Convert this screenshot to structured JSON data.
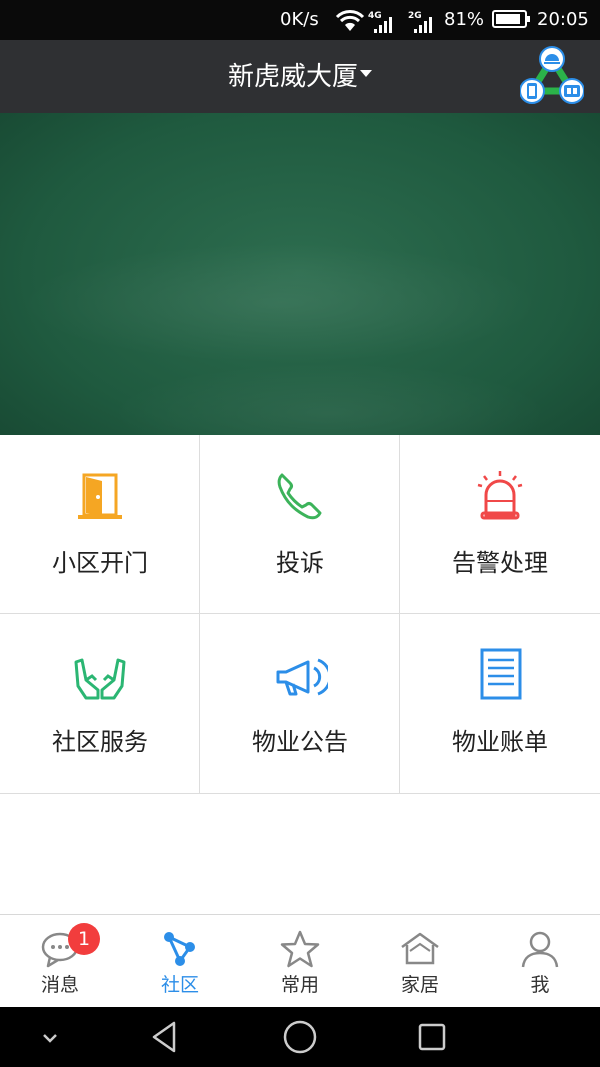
{
  "status_bar": {
    "network_speed": "0K/s",
    "net_4g": "4G",
    "net_2g": "2G",
    "battery_percent": "81%",
    "time": "20:05",
    "icons": [
      "wifi-icon",
      "signal-icon",
      "battery-icon"
    ]
  },
  "header": {
    "title": "新虎威大厦",
    "logo_icon": "smart-home-network-logo",
    "colors": {
      "background": "#2f3033",
      "title": "#ffffff"
    }
  },
  "banner": {
    "description_icon": "green-chalkboard-banner"
  },
  "services": [
    {
      "label": "小区开门",
      "icon": "door-icon",
      "color": "#f5a623"
    },
    {
      "label": "投诉",
      "icon": "phone-icon",
      "color": "#3cb35a"
    },
    {
      "label": "告警处理",
      "icon": "alarm-light-icon",
      "color": "#f04848"
    },
    {
      "label": "社区服务",
      "icon": "hands-icon",
      "color": "#2bb673"
    },
    {
      "label": "物业公告",
      "icon": "megaphone-icon",
      "color": "#2c8ee8"
    },
    {
      "label": "物业账单",
      "icon": "bill-list-icon",
      "color": "#2c8ee8"
    }
  ],
  "bottom_nav": {
    "active": "社区",
    "active_color": "#2c8ee8",
    "items": [
      {
        "label": "消息",
        "icon": "message-icon",
        "badge": "1"
      },
      {
        "label": "社区",
        "icon": "community-icon"
      },
      {
        "label": "常用",
        "icon": "star-icon"
      },
      {
        "label": "家居",
        "icon": "home-icon"
      },
      {
        "label": "我",
        "icon": "user-icon"
      }
    ]
  },
  "system_nav": {
    "icons": [
      "chevron-down-icon",
      "back-icon",
      "home-circle-icon",
      "recents-icon"
    ]
  }
}
